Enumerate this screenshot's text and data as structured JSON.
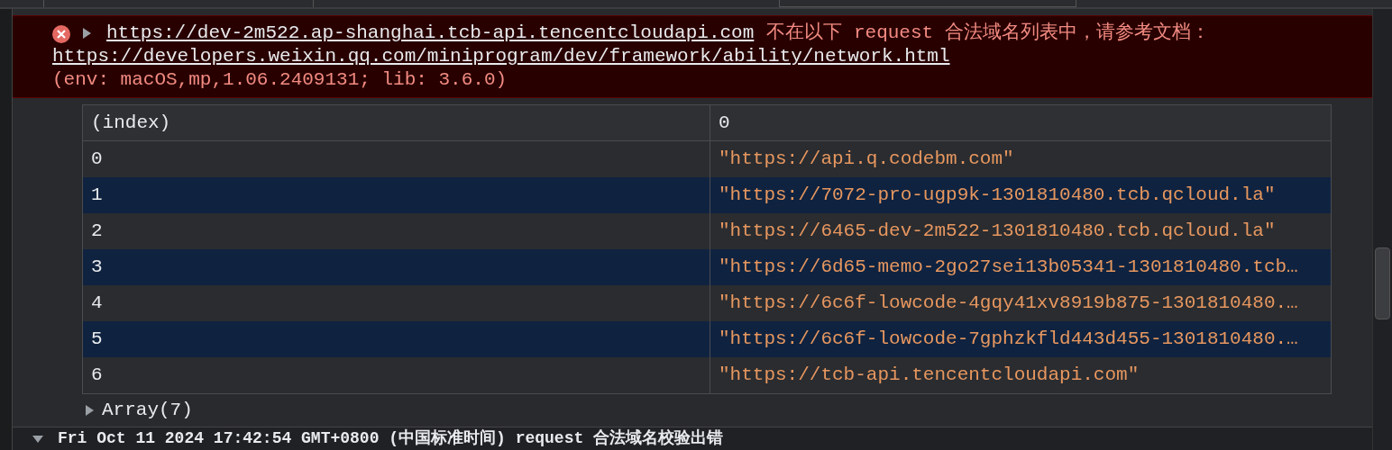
{
  "error": {
    "url": "https://dev-2m522.ap-shanghai.tcb-api.tencentcloudapi.com",
    "message": "不在以下 request 合法域名列表中，请参考文档：",
    "doc_link": "https://developers.weixin.qq.com/miniprogram/dev/framework/ability/network.html",
    "env": "(env: macOS,mp,1.06.2409131; lib: 3.6.0)",
    "expanded": false
  },
  "table": {
    "columns": [
      "(index)",
      "0"
    ],
    "rows": [
      {
        "index": "0",
        "value": "\"https://api.q.codebm.com\""
      },
      {
        "index": "1",
        "value": "\"https://7072-pro-ugp9k-1301810480.tcb.qcloud.la\""
      },
      {
        "index": "2",
        "value": "\"https://6465-dev-2m522-1301810480.tcb.qcloud.la\""
      },
      {
        "index": "3",
        "value": "\"https://6d65-memo-2go27sei13b05341-1301810480.tcb…"
      },
      {
        "index": "4",
        "value": "\"https://6c6f-lowcode-4gqy41xv8919b875-1301810480.…"
      },
      {
        "index": "5",
        "value": "\"https://6c6f-lowcode-7gphzkfld443d455-1301810480.…"
      },
      {
        "index": "6",
        "value": "\"https://tcb-api.tencentcloudapi.com\""
      }
    ]
  },
  "array_summary": {
    "label": "Array(7)",
    "expanded": false
  },
  "next_log": {
    "text": "Fri Oct 11 2024 17:42:54 GMT+0800 (中国标准时间) request 合法域名校验出错",
    "expanded": true
  }
}
